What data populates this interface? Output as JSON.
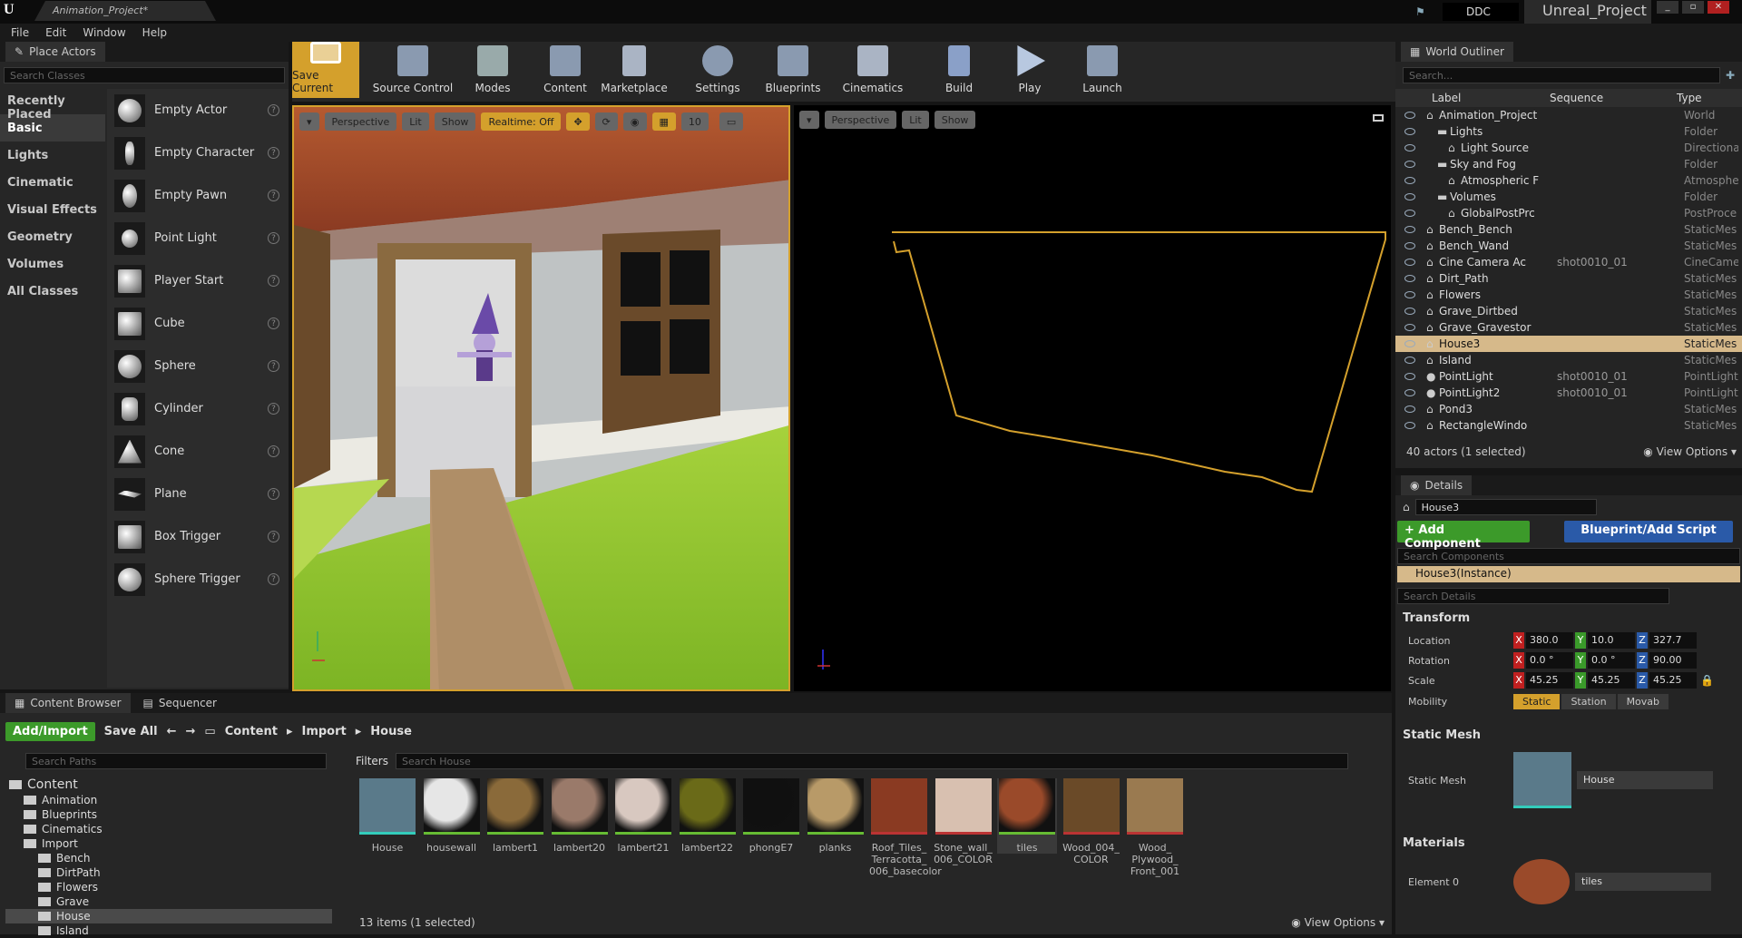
{
  "window": {
    "tab_title": "Animation_Project*",
    "project_name": "Unreal_Project",
    "ddc_label": "DDC"
  },
  "menu": [
    "File",
    "Edit",
    "Window",
    "Help"
  ],
  "place_actors": {
    "tab_label": "Place Actors",
    "search_placeholder": "Search Classes",
    "categories": [
      "Recently Placed",
      "Basic",
      "Lights",
      "Cinematic",
      "Visual Effects",
      "Geometry",
      "Volumes",
      "All Classes"
    ],
    "selected_category": "Basic",
    "actors": [
      "Empty Actor",
      "Empty Character",
      "Empty Pawn",
      "Point Light",
      "Player Start",
      "Cube",
      "Sphere",
      "Cylinder",
      "Cone",
      "Plane",
      "Box Trigger",
      "Sphere Trigger"
    ]
  },
  "toolbar": {
    "buttons": [
      {
        "label": "Save Current",
        "icon": "save-icon"
      },
      {
        "label": "Source Control",
        "icon": "source-control-icon"
      },
      {
        "label": "Modes",
        "icon": "modes-icon"
      },
      {
        "label": "Content",
        "icon": "content-icon"
      },
      {
        "label": "Marketplace",
        "icon": "marketplace-icon"
      },
      {
        "label": "Settings",
        "icon": "settings-icon"
      },
      {
        "label": "Blueprints",
        "icon": "blueprints-icon"
      },
      {
        "label": "Cinematics",
        "icon": "cinematics-icon"
      },
      {
        "label": "Build",
        "icon": "build-icon"
      },
      {
        "label": "Play",
        "icon": "play-icon"
      },
      {
        "label": "Launch",
        "icon": "launch-icon"
      }
    ]
  },
  "viewport_left": {
    "perspective": "Perspective",
    "lit": "Lit",
    "show": "Show",
    "realtime": "Realtime: Off",
    "grid_value": "10"
  },
  "viewport_right": {
    "perspective": "Perspective",
    "lit": "Lit",
    "show": "Show"
  },
  "outliner": {
    "tab_label": "World Outliner",
    "search_placeholder": "Search...",
    "col_label": "Label",
    "col_sequence": "Sequence",
    "col_type": "Type",
    "rows": [
      {
        "label": "Animation_Project",
        "sequence": "",
        "type": "World"
      },
      {
        "label": "Lights",
        "sequence": "",
        "type": "Folder"
      },
      {
        "label": "Light Source",
        "sequence": "",
        "type": "Directiona"
      },
      {
        "label": "Sky and Fog",
        "sequence": "",
        "type": "Folder"
      },
      {
        "label": "Atmospheric F",
        "sequence": "",
        "type": "Atmosphe"
      },
      {
        "label": "Volumes",
        "sequence": "",
        "type": "Folder"
      },
      {
        "label": "GlobalPostPrc",
        "sequence": "",
        "type": "PostProce"
      },
      {
        "label": "Bench_Bench",
        "sequence": "",
        "type": "StaticMes"
      },
      {
        "label": "Bench_Wand",
        "sequence": "",
        "type": "StaticMes"
      },
      {
        "label": "Cine Camera Ac",
        "sequence": "shot0010_01",
        "type": "CineCame"
      },
      {
        "label": "Dirt_Path",
        "sequence": "",
        "type": "StaticMes"
      },
      {
        "label": "Flowers",
        "sequence": "",
        "type": "StaticMes"
      },
      {
        "label": "Grave_Dirtbed",
        "sequence": "",
        "type": "StaticMes"
      },
      {
        "label": "Grave_Gravestor",
        "sequence": "",
        "type": "StaticMes"
      },
      {
        "label": "House3",
        "sequence": "",
        "type": "StaticMes"
      },
      {
        "label": "Island",
        "sequence": "",
        "type": "StaticMes"
      },
      {
        "label": "PointLight",
        "sequence": "shot0010_01",
        "type": "PointLight"
      },
      {
        "label": "PointLight2",
        "sequence": "shot0010_01",
        "type": "PointLight"
      },
      {
        "label": "Pond3",
        "sequence": "",
        "type": "StaticMes"
      },
      {
        "label": "RectangleWindo",
        "sequence": "",
        "type": "StaticMes"
      }
    ],
    "selected_row": "House3",
    "actor_count": "40 actors (1 selected)",
    "view_options": "View Options"
  },
  "details": {
    "tab_label": "Details",
    "name_value": "House3",
    "add_component": "+ Add Component",
    "blueprint_script": "Blueprint/Add Script",
    "search_components": "Search Components",
    "instance_label": "House3(Instance)",
    "search_details": "Search Details",
    "transform_header": "Transform",
    "location_label": "Location",
    "location": {
      "x": "380.0",
      "y": "10.0",
      "z": "327.7"
    },
    "rotation_label": "Rotation",
    "rotation": {
      "x": "0.0 °",
      "y": "0.0 °",
      "z": "90.00"
    },
    "scale_label": "Scale",
    "scale": {
      "x": "45.25",
      "y": "45.25",
      "z": "45.25"
    },
    "mobility_label": "Mobility",
    "mobility_options": [
      "Static",
      "Station",
      "Movab"
    ],
    "static_mesh_header": "Static Mesh",
    "static_mesh_label": "Static Mesh",
    "static_mesh_value": "House",
    "materials_header": "Materials",
    "element0_label": "Element 0",
    "element0_value": "tiles"
  },
  "content_browser": {
    "tab_label": "Content Browser",
    "sequencer_tab": "Sequencer",
    "add_import": "Add/Import",
    "save_all": "Save All",
    "breadcrumb": [
      "Content",
      "Import",
      "House"
    ],
    "search_paths": "Search Paths",
    "filters": "Filters",
    "search_house": "Search House",
    "tree": [
      {
        "label": "Content",
        "level": 0
      },
      {
        "label": "Animation",
        "level": 1
      },
      {
        "label": "Blueprints",
        "level": 1
      },
      {
        "label": "Cinematics",
        "level": 1
      },
      {
        "label": "Import",
        "level": 1
      },
      {
        "label": "Bench",
        "level": 2
      },
      {
        "label": "DirtPath",
        "level": 2
      },
      {
        "label": "Flowers",
        "level": 2
      },
      {
        "label": "Grave",
        "level": 2
      },
      {
        "label": "House",
        "level": 2
      },
      {
        "label": "Island",
        "level": 2
      }
    ],
    "assets": [
      {
        "label": "House",
        "color": "#5a7a8a"
      },
      {
        "label": "housewall",
        "color": "#e6e6e6"
      },
      {
        "label": "lambert1",
        "color": "#8a6a3a"
      },
      {
        "label": "lambert20",
        "color": "#9a7a6a"
      },
      {
        "label": "lambert21",
        "color": "#d8c8c0"
      },
      {
        "label": "lambert22",
        "color": "#6a6a18"
      },
      {
        "label": "phongE7",
        "color": "#101010"
      },
      {
        "label": "planks",
        "color": "#b89a68"
      },
      {
        "label": "Roof_Tiles_ Terracotta_ 006_basecolor",
        "color": "#8a3a22"
      },
      {
        "label": "Stone_wall_ 006_COLOR",
        "color": "#d8c0b0"
      },
      {
        "label": "tiles",
        "color": "#9a4a2a"
      },
      {
        "label": "Wood_004_ COLOR",
        "color": "#6a4a28"
      },
      {
        "label": "Wood_ Plywood_ Front_001",
        "color": "#9a7a50"
      }
    ],
    "items_count": "13 items (1 selected)",
    "view_options": "View Options"
  }
}
